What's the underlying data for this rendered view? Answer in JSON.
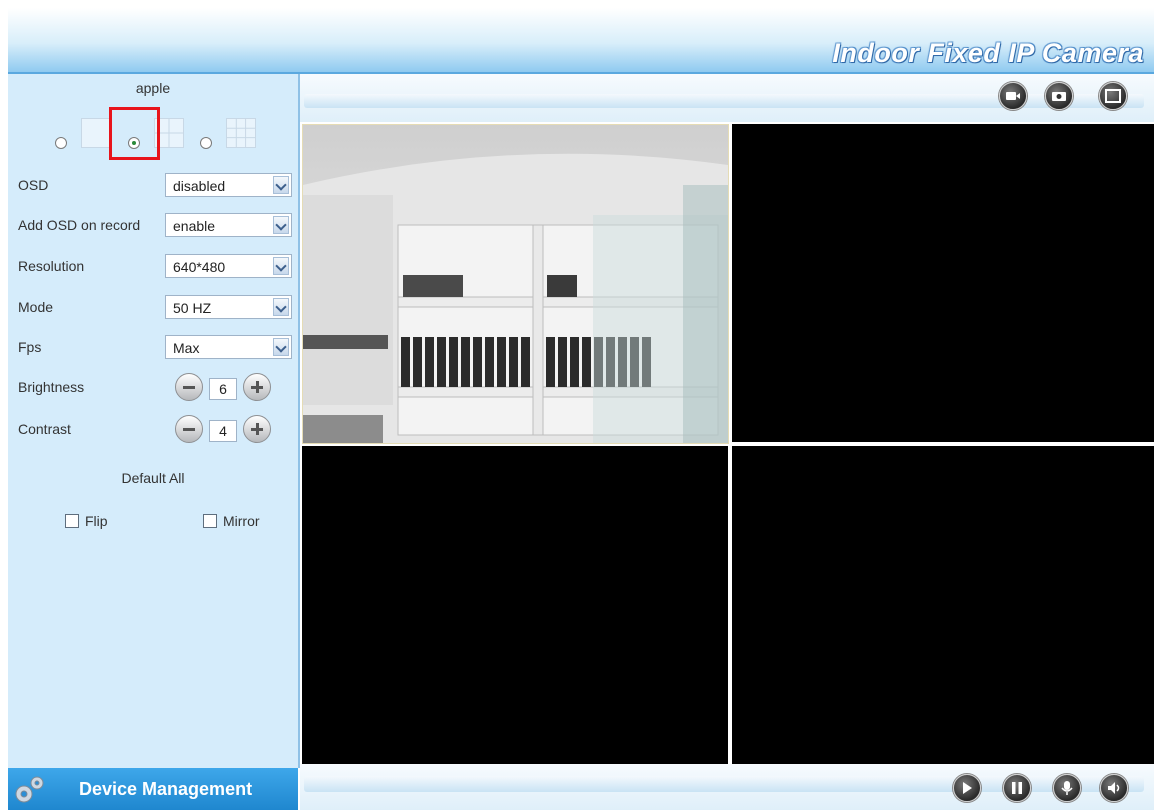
{
  "header": {
    "title": "Indoor Fixed IP Camera"
  },
  "sidebar": {
    "camera_name": "apple",
    "layouts": [
      {
        "name": "single",
        "checked": false
      },
      {
        "name": "quad",
        "checked": true
      },
      {
        "name": "nine",
        "checked": false
      }
    ],
    "osd": {
      "label": "OSD",
      "value": "disabled"
    },
    "add_osd_on_record": {
      "label": "Add OSD on record",
      "value": "enable"
    },
    "resolution": {
      "label": "Resolution",
      "value": "640*480"
    },
    "mode": {
      "label": "Mode",
      "value": "50 HZ"
    },
    "fps": {
      "label": "Fps",
      "value": "Max"
    },
    "brightness": {
      "label": "Brightness",
      "value": "6"
    },
    "contrast": {
      "label": "Contrast",
      "value": "4"
    },
    "default_all": "Default All",
    "flip": {
      "label": "Flip",
      "checked": false
    },
    "mirror": {
      "label": "Mirror",
      "checked": false
    }
  },
  "device_management": {
    "label": "Device Management",
    "icon": "gear-icon"
  },
  "toolbar_top": {
    "icons": [
      "record-icon",
      "snapshot-icon",
      "fullscreen-icon"
    ]
  },
  "toolbar_bottom": {
    "icons": [
      "play-icon",
      "pause-icon",
      "talk-icon",
      "audio-icon"
    ]
  },
  "colors": {
    "accent": "#1f87cf",
    "highlight": "#e8141b",
    "sidebar": "#d5ecfb"
  }
}
